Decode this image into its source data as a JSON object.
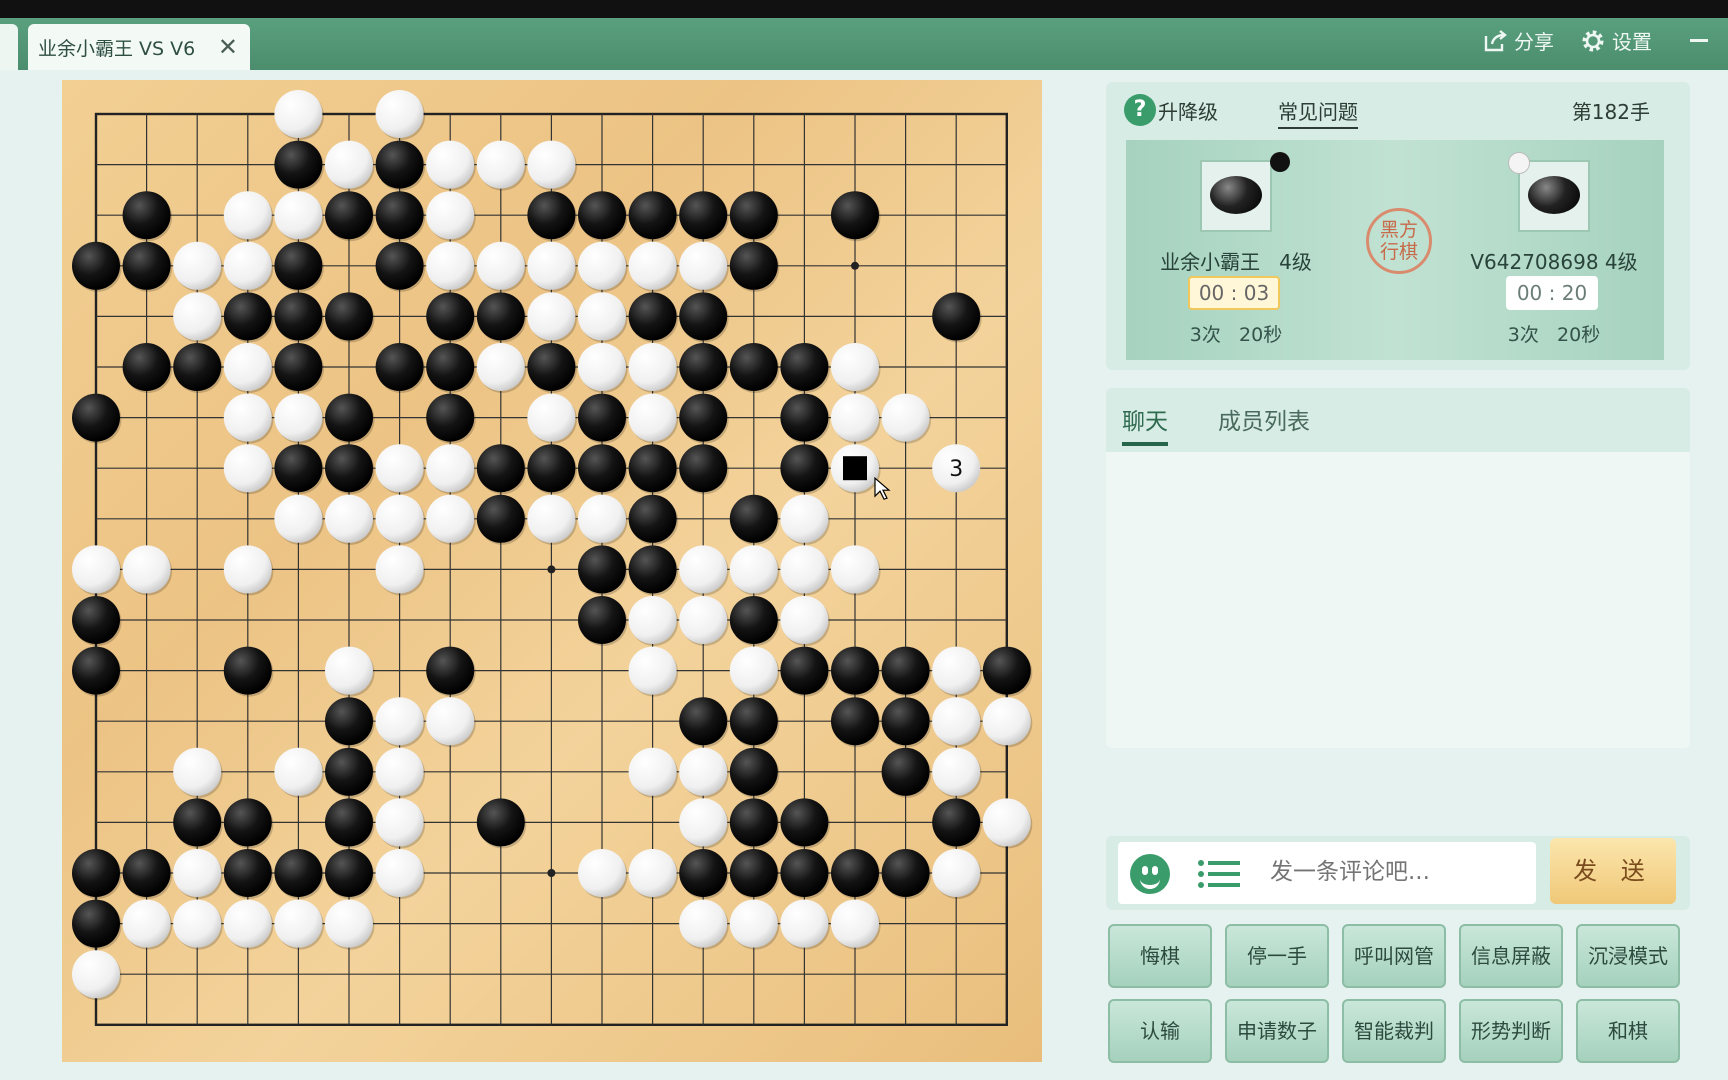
{
  "window": {
    "tab_title": "业余小霸王 VS V6",
    "share_label": "分享",
    "settings_label": "设置"
  },
  "game_header": {
    "rank_label": "升降级",
    "faq_label": "常见问题",
    "move_count": "第182手"
  },
  "players": {
    "black": {
      "name": "业余小霸王",
      "rank": "4级",
      "timer": "00 : 03",
      "byo_count": "3次",
      "byo_time": "20秒"
    },
    "white": {
      "name": "V642708698",
      "rank": "4级",
      "timer": "00 : 20",
      "byo_count": "3次",
      "byo_time": "20秒"
    },
    "turn_seal_line1": "黑方",
    "turn_seal_line2": "行棋"
  },
  "chat": {
    "tab_chat": "聊天",
    "tab_members": "成员列表",
    "input_placeholder": "发一条评论吧...",
    "send_label": "发 送"
  },
  "buttons": {
    "row1": [
      "悔棋",
      "停一手",
      "呼叫网管",
      "信息屏蔽",
      "沉浸模式"
    ],
    "row2": [
      "认输",
      "申请数子",
      "智能裁判",
      "形势判断",
      "和棋"
    ]
  },
  "colors": {
    "accent": "#4b8d6d",
    "send": "#f0c878",
    "board": "#ecc384"
  },
  "board": {
    "size": 19,
    "board_rows": [
      "....W.W............",
      "....BWBWWW.........",
      ".B.WWBBW.BBBBB.B...",
      "BBWWB.BWWWWWWB.....",
      "..WBBB.BBWWBB....B.",
      ".BBWB.BBWBWWBBBW...",
      "B..WWB.B.WBWB.BWW..",
      "...WBBWWBBBBB.BW...",
      "....WWWWBWWB.BW....",
      "WW.W..W...BBWWWW...",
      "B.........BWWBW....",
      "B..B.W.B...W.WBBBWB",
      ".....BWW....BB.BBWW",
      "..W.WBW....WWB..BW.",
      "..BB.BW.B...WBB..BW",
      "BBWBBBW...WWBBBBBW.",
      "BWWWWW......WWWW...",
      "W..................",
      "..................."
    ],
    "last_move": {
      "col": 15,
      "row": 7
    },
    "number_marker": {
      "col": 17,
      "row": 7,
      "label": "3"
    }
  }
}
